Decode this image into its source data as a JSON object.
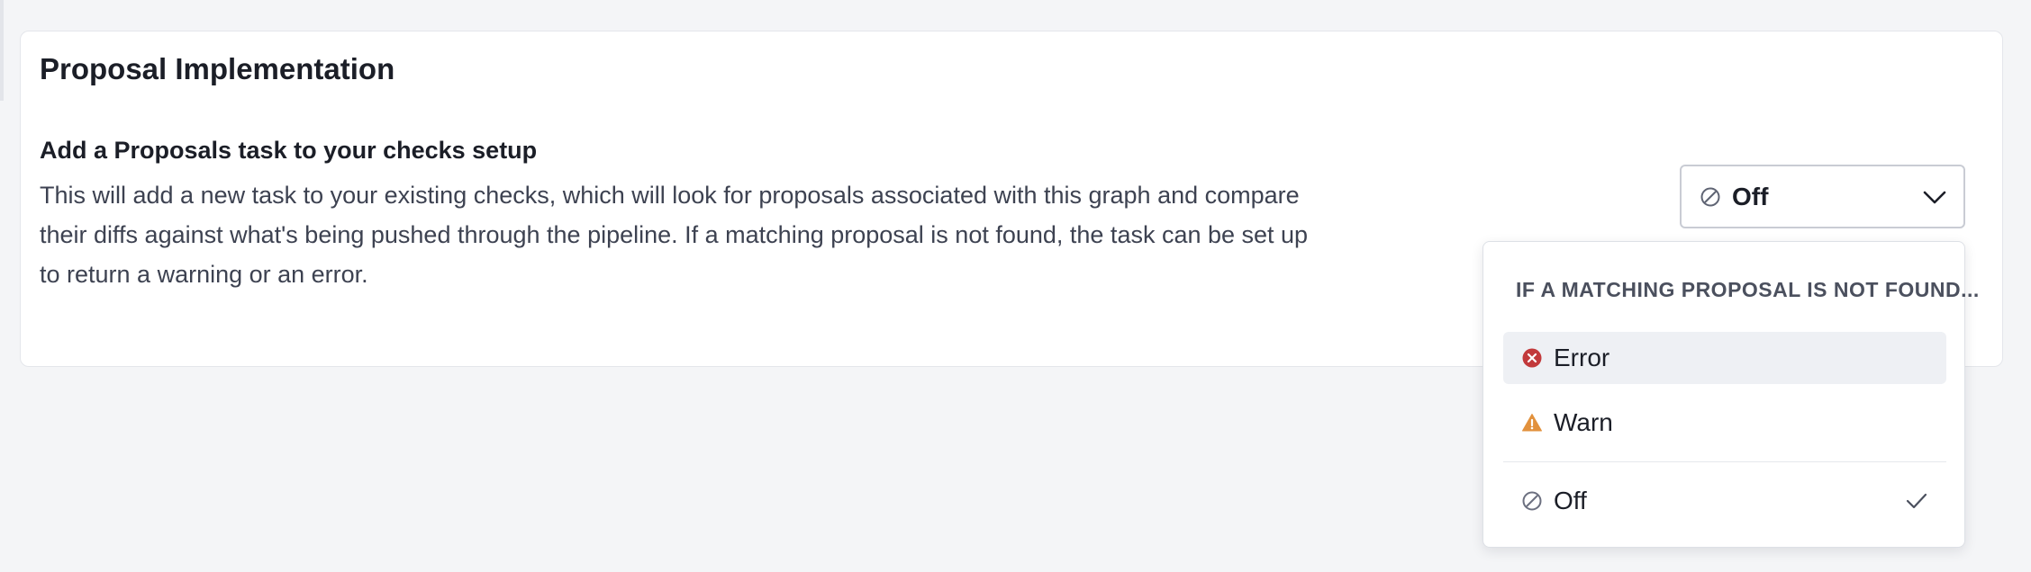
{
  "card": {
    "title": "Proposal Implementation"
  },
  "setting": {
    "title": "Add a Proposals task to your checks setup",
    "description": "This will add a new task to your existing checks, which will look for proposals associated with this graph and compare their diffs against what's being pushed through the pipeline. If a matching proposal is not found, the task can be set up to return a warning or an error."
  },
  "select": {
    "value": "Off",
    "icon": "off-circle-icon",
    "chevron": "chevron-down-icon"
  },
  "menu": {
    "header": "IF A MATCHING PROPOSAL IS NOT FOUND...",
    "options": [
      {
        "label": "Error",
        "icon": "error-circle-icon",
        "color": "#c2393b",
        "hovered": true
      },
      {
        "label": "Warn",
        "icon": "warning-triangle-icon",
        "color": "#e2913d",
        "hovered": false
      },
      {
        "label": "Off",
        "icon": "off-circle-icon",
        "color": "#6c7080",
        "selected": true
      }
    ]
  },
  "colors": {
    "background": "#f4f5f7",
    "card": "#ffffff",
    "text": "#1b1e27",
    "muted_text": "#3d4251",
    "error": "#c2393b",
    "warn": "#e2913d",
    "hover": "#eef0f4"
  }
}
